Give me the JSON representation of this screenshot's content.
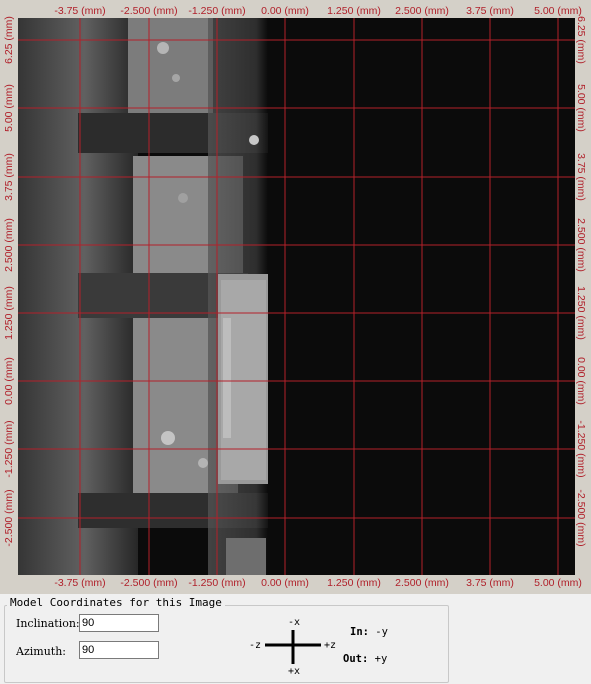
{
  "viewer": {
    "grid_color": "#b3202a",
    "x_ticks": [
      "-3.75 (mm)",
      "-2.500 (mm)",
      "-1.250 (mm)",
      "0.00 (mm)",
      "1.250 (mm)",
      "2.500 (mm)",
      "3.75 (mm)",
      "5.00 (mm)"
    ],
    "y_ticks": [
      "6.25 (mm)",
      "5.00 (mm)",
      "3.75 (mm)",
      "2.500 (mm)",
      "1.250 (mm)",
      "0.00 (mm)",
      "-1.250 (mm)",
      "-2.500 (mm)"
    ]
  },
  "panel": {
    "title": "Model Coordinates for this Image",
    "inclination_label": "Inclination:",
    "inclination_value": "90",
    "azimuth_label": "Azimuth:",
    "azimuth_value": "90",
    "axes": {
      "up": "-x",
      "down": "+x",
      "left": "-z",
      "right": "+z"
    },
    "in_label": "In:",
    "in_value": "-y",
    "out_label": "Out:",
    "out_value": "+y"
  }
}
